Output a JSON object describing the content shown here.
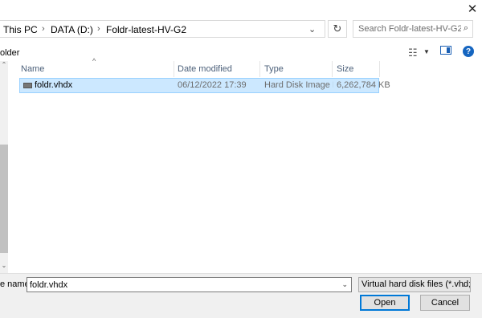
{
  "window": {
    "close_symbol": "✕"
  },
  "address_bar": {
    "breadcrumbs": [
      "This PC",
      "DATA (D:)",
      "Foldr-latest-HV-G2"
    ],
    "separator": "›",
    "dropdown_symbol": "⌄",
    "refresh_symbol": "↻"
  },
  "search": {
    "placeholder": "Search Foldr-latest-HV-G2",
    "icon_symbol": "⌕"
  },
  "toolbar": {
    "new_folder_partial": "older",
    "view_icon_symbol": "☷",
    "view_dropdown_symbol": "▼",
    "help_symbol": "?"
  },
  "file_list": {
    "columns": [
      "Name",
      "Date modified",
      "Type",
      "Size"
    ],
    "sort_indicator": "^",
    "rows": [
      {
        "name": "foldr.vhdx",
        "date_modified": "06/12/2022 17:39",
        "type": "Hard Disk Image F...",
        "size": "6,262,784 KB",
        "selected": true
      }
    ]
  },
  "left_pane": {
    "scroll_up": "⌃",
    "scroll_down": "⌄"
  },
  "footer": {
    "filename_label": "e name:",
    "filename_value": "foldr.vhdx",
    "filename_dropdown_symbol": "⌄",
    "filter_value": "Virtual hard disk files   (*.vhd;*.",
    "filter_dropdown_symbol": "⌄",
    "open_label": "Open",
    "cancel_label": "Cancel"
  },
  "colors": {
    "selection_bg": "#cce8ff",
    "selection_border": "#99d1ff",
    "accent": "#0078d7",
    "header_text": "#4c607a"
  }
}
